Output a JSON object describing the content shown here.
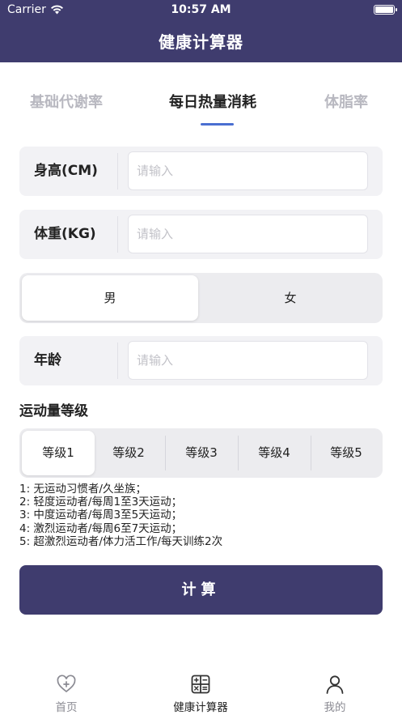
{
  "status_bar": {
    "carrier": "Carrier",
    "time": "10:57 AM"
  },
  "nav": {
    "title": "健康计算器"
  },
  "tabs": [
    {
      "label": "基础代谢率",
      "active": false
    },
    {
      "label": "每日热量消耗",
      "active": true
    },
    {
      "label": "体脂率",
      "active": false
    }
  ],
  "form": {
    "height": {
      "label": "身高(CM)",
      "value": "",
      "placeholder": "请输入"
    },
    "weight": {
      "label": "体重(KG)",
      "value": "",
      "placeholder": "请输入"
    },
    "gender": {
      "options": [
        "男",
        "女"
      ],
      "selected": "男"
    },
    "age": {
      "label": "年龄",
      "value": "",
      "placeholder": "请输入"
    }
  },
  "activity": {
    "title": "运动量等级",
    "levels": [
      "等级1",
      "等级2",
      "等级3",
      "等级4",
      "等级5"
    ],
    "selected": "等级1",
    "descriptions": [
      "1:  无运动习惯者/久坐族；",
      "2:  轻度运动者/每周1至3天运动；",
      "3:  中度运动者/每周3至5天运动；",
      "4:  激烈运动者/每周6至7天运动；",
      "5:  超激烈运动者/体力活工作/每天训练2次"
    ]
  },
  "calculate_button": "计算",
  "tabbar": [
    {
      "label": "首页",
      "icon": "heart-plus-icon",
      "active": false
    },
    {
      "label": "健康计算器",
      "icon": "calculator-icon",
      "active": true
    },
    {
      "label": "我的",
      "icon": "person-icon",
      "active": false
    }
  ],
  "colors": {
    "primary": "#3f3c6e",
    "tab_indicator": "#4a6fd1"
  }
}
